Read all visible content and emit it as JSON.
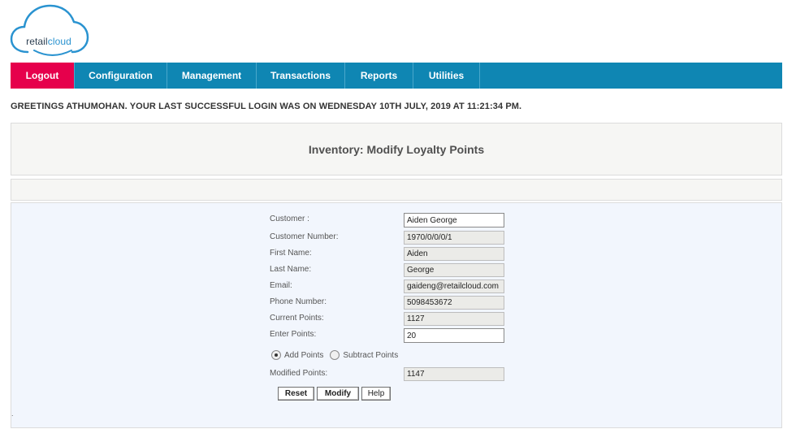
{
  "brand": {
    "retail": "retail",
    "cloud": "cloud",
    "accent": "#2a93d0"
  },
  "nav": {
    "items": [
      {
        "label": "Logout",
        "color": "#e6004c"
      },
      {
        "label": "Configuration"
      },
      {
        "label": "Management"
      },
      {
        "label": "Transactions"
      },
      {
        "label": "Reports"
      },
      {
        "label": "Utilities"
      }
    ],
    "bar_color": "#0f86b3"
  },
  "greeting": "GREETINGS ATHUMOHAN. YOUR LAST SUCCESSFUL LOGIN WAS ON WEDNESDAY 10TH JULY, 2019 AT 11:21:34 PM.",
  "page_title": "Inventory: Modify Loyalty Points",
  "stray_mark": ".",
  "form": {
    "customer": {
      "label": "Customer :",
      "value": "Aiden George"
    },
    "customer_number": {
      "label": "Customer Number:",
      "value": "1970/0/0/0/1"
    },
    "first_name": {
      "label": "First Name:",
      "value": "Aiden"
    },
    "last_name": {
      "label": "Last Name:",
      "value": "George"
    },
    "email": {
      "label": "Email:",
      "value": "gaideng@retailcloud.com"
    },
    "phone": {
      "label": "Phone Number:",
      "value": "5098453672"
    },
    "current_points": {
      "label": "Current Points:",
      "value": "1127"
    },
    "enter_points": {
      "label": "Enter Points:",
      "value": "20"
    },
    "add_points": {
      "label": "Add Points",
      "selected": true
    },
    "subtract_points": {
      "label": "Subtract Points",
      "selected": false
    },
    "modified_points": {
      "label": "Modified Points:",
      "value": "1147"
    }
  },
  "buttons": {
    "reset": "Reset",
    "modify": "Modify",
    "help": "Help"
  }
}
